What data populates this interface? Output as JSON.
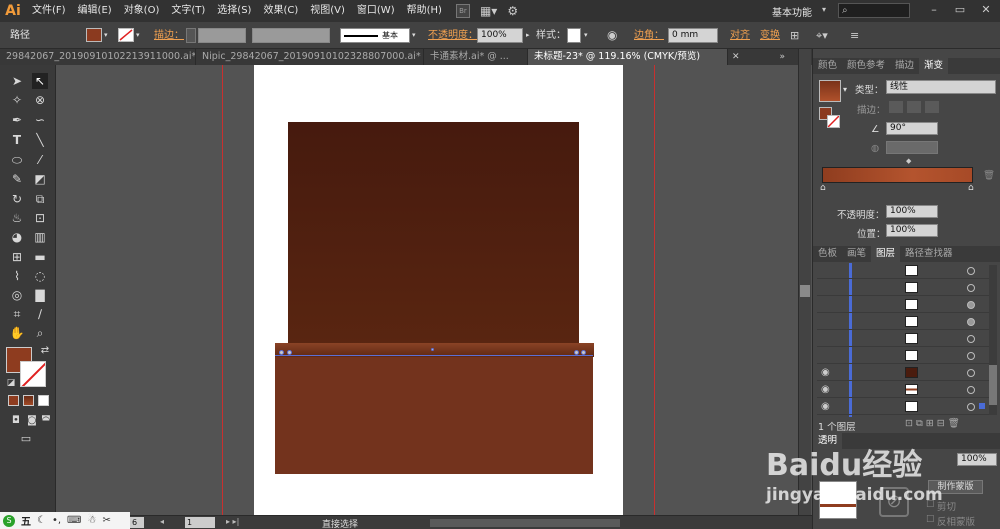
{
  "app": {
    "logo": "Ai",
    "workspace": "基本功能"
  },
  "menu": [
    "文件(F)",
    "编辑(E)",
    "对象(O)",
    "文字(T)",
    "选择(S)",
    "效果(C)",
    "视图(V)",
    "窗口(W)",
    "帮助(H)"
  ],
  "menu_mini": "Br",
  "control": {
    "object_type": "路径",
    "stroke_label": "描边：",
    "brush_label": "基本",
    "opacity_label": "不透明度：",
    "opacity_value": "100%",
    "style_label": "样式：",
    "corner_label": "边角：",
    "corner_value": "0 mm",
    "align_label": "对齐",
    "transform_label": "变换",
    "fill_color": "#8b3a1f"
  },
  "tabs": [
    {
      "label": "29842067_20190910102213911000.ai* ...",
      "active": false
    },
    {
      "label": "Nipic_29842067_20190910102328807000.ai* ...",
      "active": false
    },
    {
      "label": "卡通素材.ai* @ ...",
      "active": false
    },
    {
      "label": "未标题-23* @ 119.16% (CMYK/预览)",
      "active": true
    }
  ],
  "status": {
    "zoom": "6",
    "page": "1",
    "tool": "直接选择"
  },
  "gradient_panel": {
    "tabs": [
      "颜色",
      "颜色参考",
      "描边",
      "渐变"
    ],
    "type_label": "类型：",
    "type_value": "线性",
    "stroke_label": "描边：",
    "angle_value": "90°",
    "opacity_label": "不透明度：",
    "opacity_value": "100%",
    "location_label": "位置：",
    "location_value": "100%"
  },
  "layers_panel": {
    "tabs": [
      "色板",
      "画笔",
      "图层",
      "路径查找器"
    ],
    "footer": "1 个图层"
  },
  "transparency_panel": {
    "tab": "透明",
    "opacity_value": "100%",
    "make_mask": "制作蒙版",
    "clip": "剪切",
    "invert_mask": "反相蒙版"
  },
  "watermark": {
    "brand": "Baidu经验",
    "url": "jingyan.baidu.com"
  },
  "taskbar": {
    "ime": "五"
  }
}
